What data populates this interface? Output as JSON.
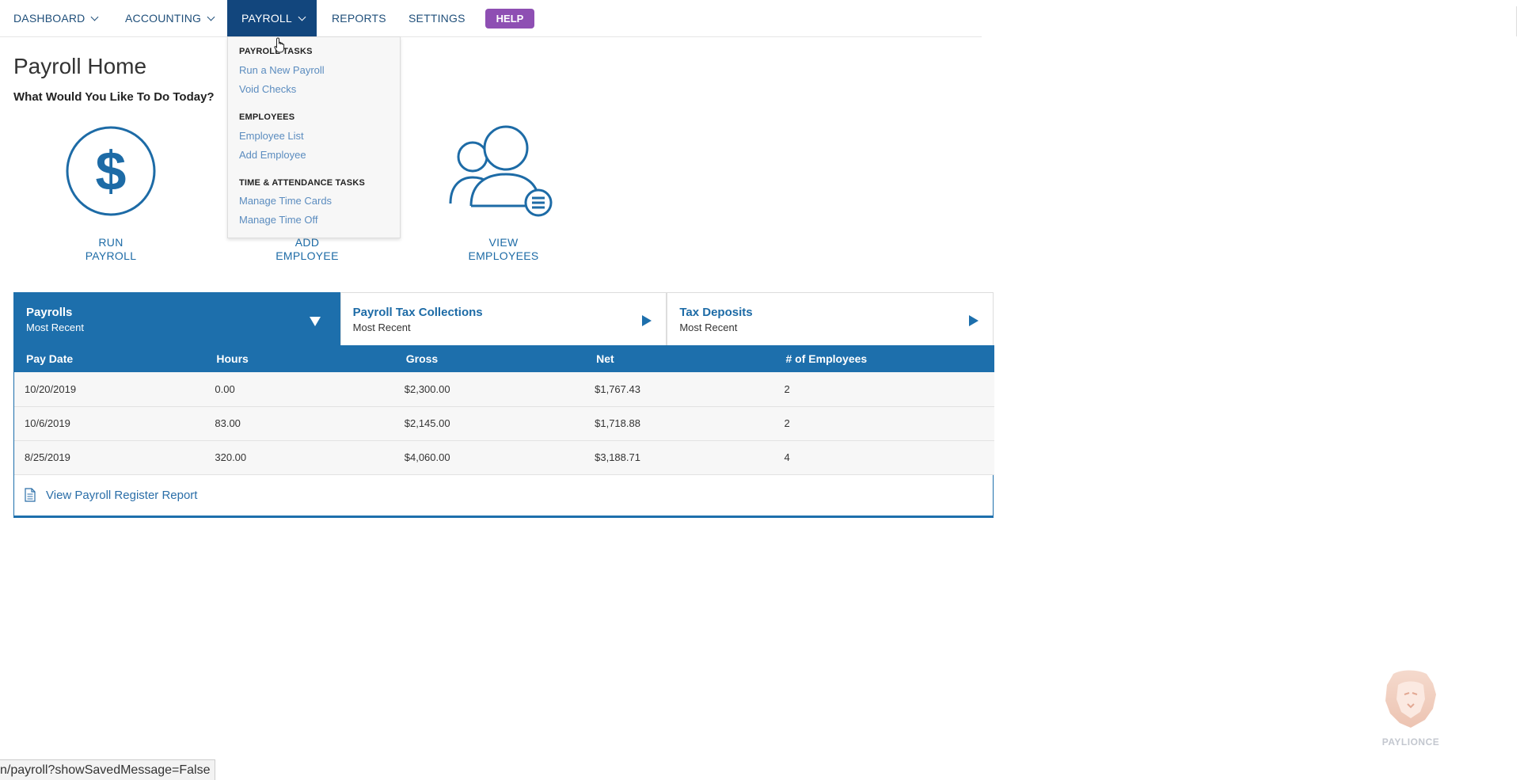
{
  "nav": {
    "dashboard": "DASHBOARD",
    "accounting": "ACCOUNTING",
    "payroll": "PAYROLL",
    "reports": "REPORTS",
    "settings": "SETTINGS",
    "help": "HELP"
  },
  "dropdown": {
    "section1": "PAYROLL TASKS",
    "run_payroll": "Run a New Payroll",
    "void_checks": "Void Checks",
    "section2": "EMPLOYEES",
    "employee_list": "Employee List",
    "add_employee": "Add Employee",
    "section3": "TIME & ATTENDANCE TASKS",
    "manage_time_cards": "Manage Time Cards",
    "manage_time_off": "Manage Time Off"
  },
  "page": {
    "title": "Payroll Home",
    "subtitle": "What Would You Like To Do Today?"
  },
  "actions": [
    {
      "line1": "RUN",
      "line2": "PAYROLL",
      "icon": "dollar-circle-icon"
    },
    {
      "line1": "ADD",
      "line2": "EMPLOYEE",
      "icon": "add-user-icon"
    },
    {
      "line1": "VIEW",
      "line2": "EMPLOYEES",
      "icon": "users-list-icon"
    }
  ],
  "tabs": [
    {
      "title": "Payrolls",
      "sub": "Most Recent"
    },
    {
      "title": "Payroll Tax Collections",
      "sub": "Most Recent"
    },
    {
      "title": "Tax Deposits",
      "sub": "Most Recent"
    }
  ],
  "table": {
    "headers": [
      "Pay Date",
      "Hours",
      "Gross",
      "Net",
      "# of Employees"
    ],
    "rows": [
      [
        "10/20/2019",
        "0.00",
        "$2,300.00",
        "$1,767.43",
        "2"
      ],
      [
        "10/6/2019",
        "83.00",
        "$2,145.00",
        "$1,718.88",
        "2"
      ],
      [
        "8/25/2019",
        "320.00",
        "$4,060.00",
        "$3,188.71",
        "4"
      ]
    ]
  },
  "report_link": "View Payroll Register Report",
  "status_url": "n/payroll?showSavedMessage=False",
  "logo_text": "PAYLIONCE",
  "colors": {
    "primary": "#1d6fac",
    "nav_active": "#12467d",
    "help": "#8e4fb3",
    "link": "#5b8cbf"
  }
}
